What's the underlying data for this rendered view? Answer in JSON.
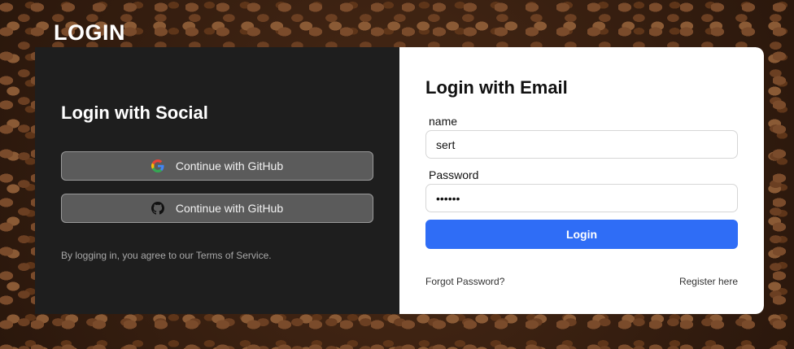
{
  "page": {
    "title": "LOGIN"
  },
  "social": {
    "heading": "Login with Social",
    "buttons": [
      {
        "label": "Continue with GitHub",
        "icon": "google-icon"
      },
      {
        "label": "Continue with GitHub",
        "icon": "github-icon"
      }
    ],
    "terms": "By logging in, you agree to our Terms of Service."
  },
  "email": {
    "heading": "Login with Email",
    "name_label": "name",
    "name_value": "sert",
    "password_label": "Password",
    "password_value": "sertxx",
    "login_label": "Login",
    "forgot_label": "Forgot Password?",
    "register_label": "Register here"
  },
  "colors": {
    "accent": "#2f6df6",
    "left_panel": "#1e1e1e",
    "social_button": "#5b5b5b"
  }
}
